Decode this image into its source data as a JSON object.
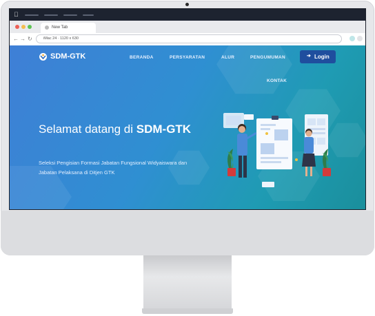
{
  "browser": {
    "tab_title": "New Tab",
    "url_text": "iMac 24 · 1120 x 630"
  },
  "site": {
    "logo_text": "SDM-GTK",
    "nav": {
      "beranda": "BERANDA",
      "persyaratan": "PERSYARATAN",
      "alur": "ALUR",
      "pengumuman": "PENGUMUMAN",
      "kontak": "KONTAK"
    },
    "login_label": "Login",
    "hero": {
      "title_regular": "Selamat datang di ",
      "title_bold": "SDM-GTK",
      "subtitle": "Seleksi Pengisian Formasi Jabatan Fungsional Widyaiswara dan Jabatan Pelaksana di Ditjen GTK"
    }
  },
  "colors": {
    "hero_gradient_start": "#3f7fd6",
    "hero_gradient_end": "#1a8f9c",
    "login_button": "#1f4e9e",
    "mac_menubar": "#1d2330"
  },
  "icons": [
    "apple-icon",
    "back-icon",
    "forward-icon",
    "reload-icon",
    "logo-icon",
    "login-icon"
  ]
}
